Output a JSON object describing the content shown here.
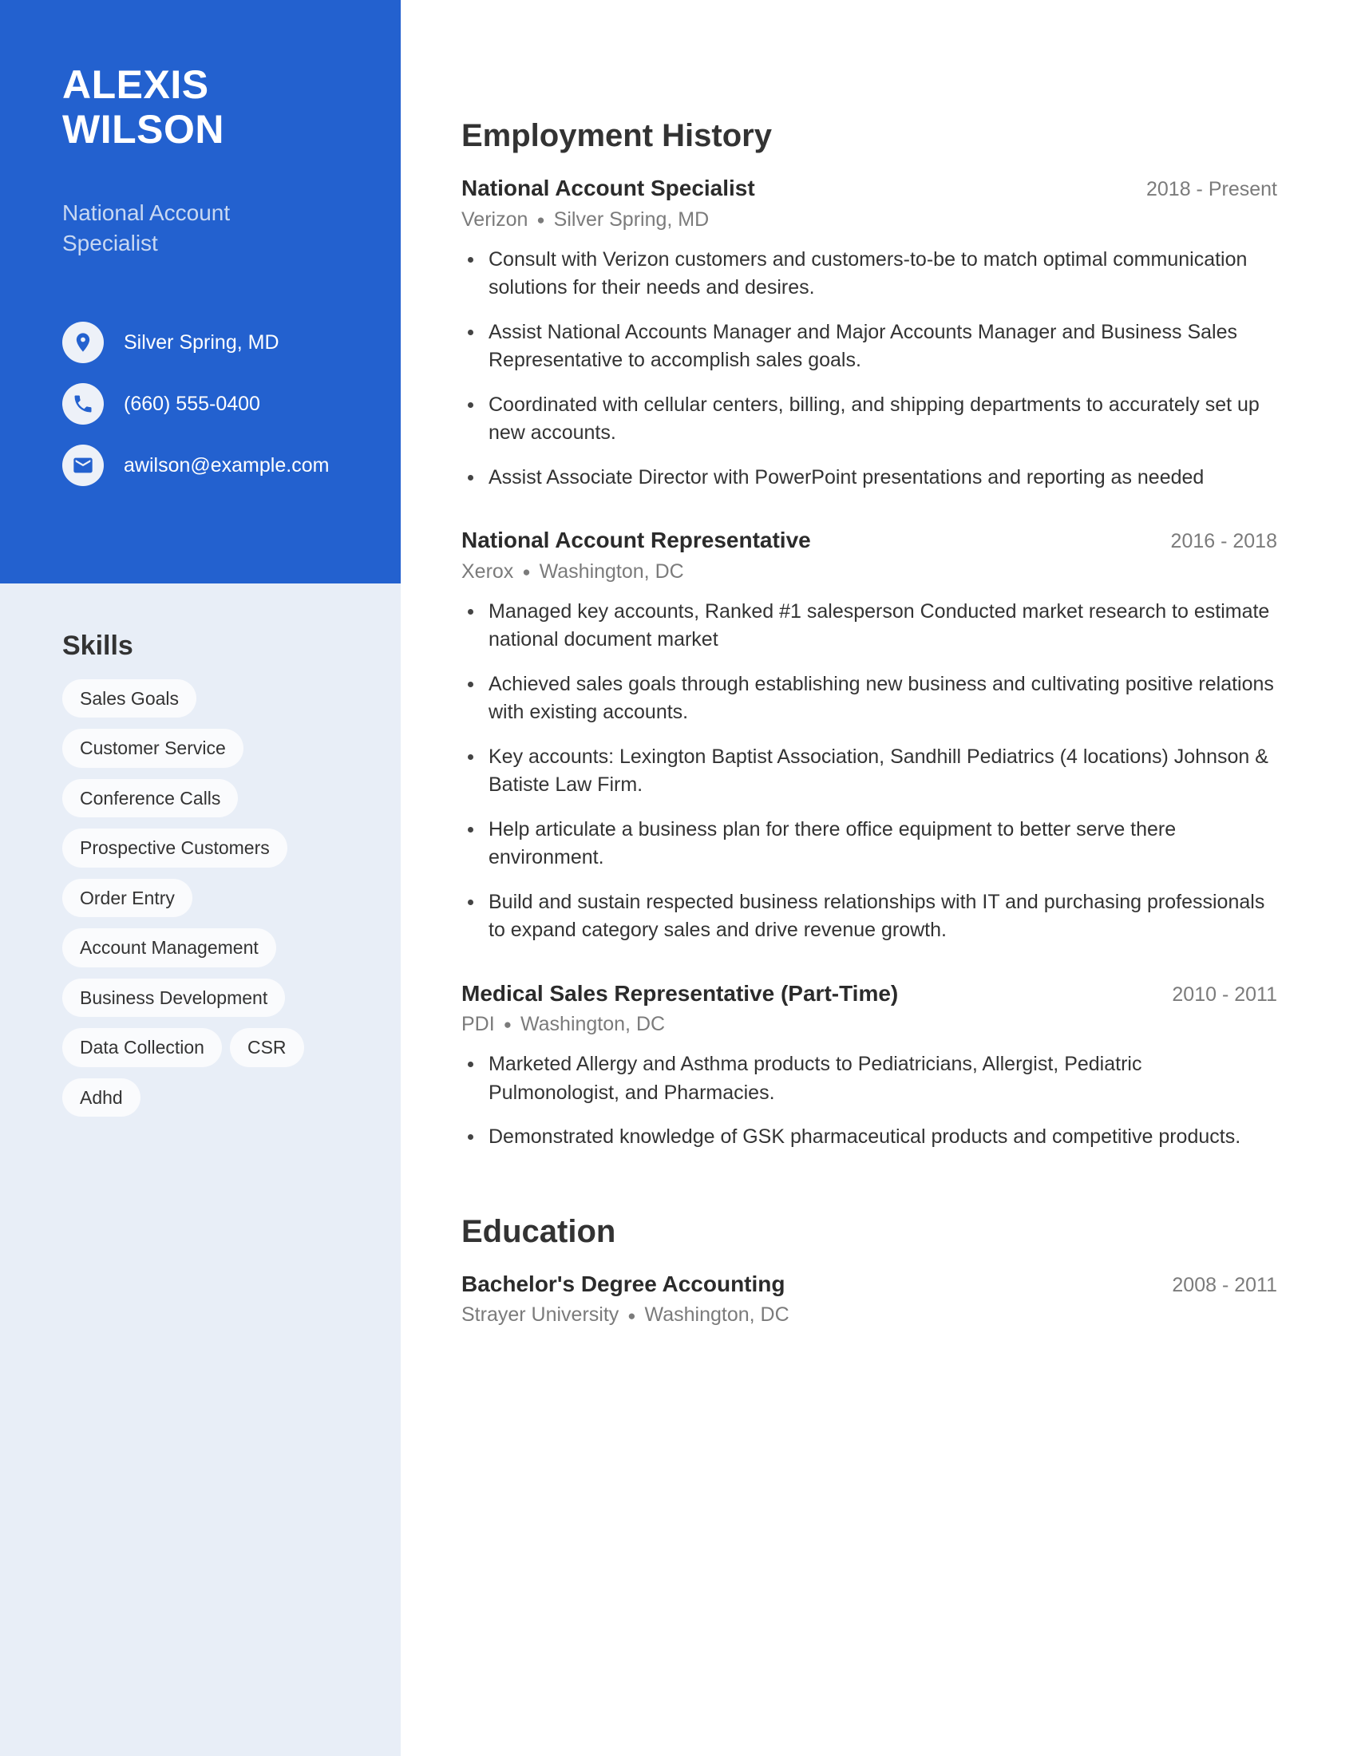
{
  "colors": {
    "sidebar_header_blue": "#2361CF",
    "sidebar_body_blue": "#E8EEF7",
    "chip_white": "#FAFBFD",
    "job_title_muted": "#C8D8F2",
    "text_dark": "#333333",
    "text_muted": "#7b7b7b"
  },
  "sidebar": {
    "first_name": "ALEXIS",
    "last_name": "WILSON",
    "job_title": "National Account Specialist",
    "contacts": [
      {
        "icon": "location-pin-icon",
        "text": "Silver Spring, MD"
      },
      {
        "icon": "phone-icon",
        "text": "(660) 555-0400"
      },
      {
        "icon": "email-icon",
        "text": "awilson@example.com"
      }
    ],
    "skills_heading": "Skills",
    "skills": [
      "Sales Goals",
      "Customer Service",
      "Conference Calls",
      "Prospective Customers",
      "Order Entry",
      "Account Management",
      "Business Development",
      "Data Collection",
      "CSR",
      "Adhd"
    ]
  },
  "main": {
    "employment_heading": "Employment History",
    "education_heading": "Education",
    "jobs": [
      {
        "title": "National Account Specialist",
        "date": "2018 - Present",
        "company": "Verizon",
        "location": "Silver Spring, MD",
        "bullets": [
          "Consult with Verizon customers and customers-to-be to match optimal communication solutions for their needs and desires.",
          "Assist National Accounts Manager and Major Accounts Manager and Business Sales Representative to accomplish sales goals.",
          "Coordinated with cellular centers, billing, and shipping departments to accurately set up new accounts.",
          "Assist Associate Director with PowerPoint presentations and reporting as needed"
        ]
      },
      {
        "title": "National Account Representative",
        "date": "2016 - 2018",
        "company": "Xerox",
        "location": "Washington, DC",
        "bullets": [
          "Managed key accounts, Ranked #1 salesperson Conducted market research to estimate national document market",
          "Achieved sales goals through establishing new business and cultivating positive relations with existing accounts.",
          "Key accounts: Lexington Baptist Association, Sandhill Pediatrics (4 locations) Johnson & Batiste Law Firm.",
          "Help articulate a business plan for there office equipment to better serve there environment.",
          "Build and sustain respected business relationships with IT and purchasing professionals to expand category sales and drive revenue growth."
        ]
      },
      {
        "title": "Medical Sales Representative (Part-Time)",
        "date": "2010 - 2011",
        "company": "PDI",
        "location": "Washington, DC",
        "bullets": [
          "Marketed Allergy and Asthma products to Pediatricians, Allergist, Pediatric Pulmonologist, and Pharmacies.",
          "Demonstrated knowledge of GSK pharmaceutical products and competitive products."
        ]
      }
    ],
    "education": [
      {
        "title": "Bachelor's Degree Accounting",
        "date": "2008 - 2011",
        "school": "Strayer University",
        "location": "Washington, DC"
      }
    ]
  }
}
